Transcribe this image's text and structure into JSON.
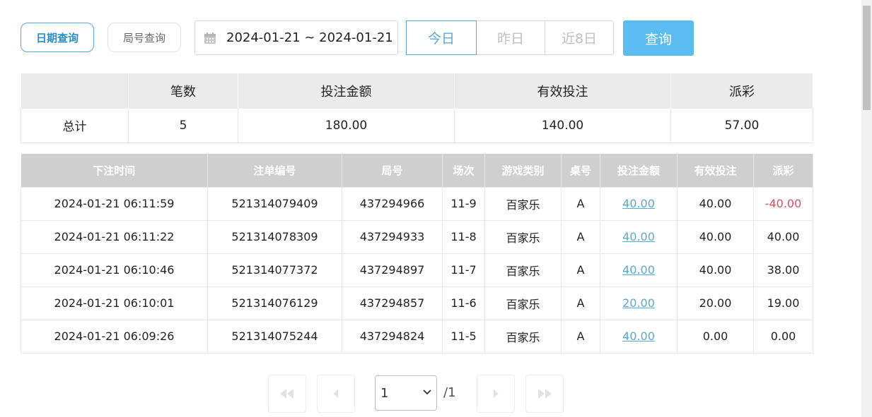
{
  "toolbar": {
    "date_query_label": "日期查询",
    "round_query_label": "局号查询",
    "date_range": "2024-01-21 ~ 2024-01-21",
    "quick_ranges": [
      "今日",
      "昨日",
      "近8日"
    ],
    "active_quick": "今日",
    "query_label": "查询"
  },
  "summary": {
    "headers": [
      "",
      "笔数",
      "投注金额",
      "有效投注",
      "派彩"
    ],
    "row": {
      "label": "总计",
      "count": "5",
      "bet_amount": "180.00",
      "valid_bet": "140.00",
      "payout": "57.00"
    }
  },
  "details": {
    "headers": [
      "下注时间",
      "注单编号",
      "局号",
      "场次",
      "游戏类别",
      "桌号",
      "投注金额",
      "有效投注",
      "派彩"
    ],
    "rows": [
      {
        "time": "2024-01-21 06:11:59",
        "order_no": "521314079409",
        "round_no": "437294966",
        "session": "11-9",
        "game": "百家乐",
        "table": "A",
        "bet": "40.00",
        "valid": "40.00",
        "payout": "-40.00"
      },
      {
        "time": "2024-01-21 06:11:22",
        "order_no": "521314078309",
        "round_no": "437294933",
        "session": "11-8",
        "game": "百家乐",
        "table": "A",
        "bet": "40.00",
        "valid": "40.00",
        "payout": "40.00"
      },
      {
        "time": "2024-01-21 06:10:46",
        "order_no": "521314077372",
        "round_no": "437294897",
        "session": "11-7",
        "game": "百家乐",
        "table": "A",
        "bet": "40.00",
        "valid": "40.00",
        "payout": "38.00"
      },
      {
        "time": "2024-01-21 06:10:01",
        "order_no": "521314076129",
        "round_no": "437294857",
        "session": "11-6",
        "game": "百家乐",
        "table": "A",
        "bet": "20.00",
        "valid": "20.00",
        "payout": "19.00"
      },
      {
        "time": "2024-01-21 06:09:26",
        "order_no": "521314075244",
        "round_no": "437294824",
        "session": "11-5",
        "game": "百家乐",
        "table": "A",
        "bet": "40.00",
        "valid": "0.00",
        "payout": "0.00"
      }
    ]
  },
  "pager": {
    "current_page": "1",
    "total_pages": "/1"
  },
  "icons": {
    "calendar": "calendar-icon",
    "first": "first-page-icon",
    "prev": "prev-page-icon",
    "next": "next-page-icon",
    "last": "last-page-icon"
  },
  "colors": {
    "accent": "#5aa9d6",
    "query_button": "#5bbcf2",
    "negative": "#e0505a",
    "header_gray": "#cfcfcf"
  }
}
